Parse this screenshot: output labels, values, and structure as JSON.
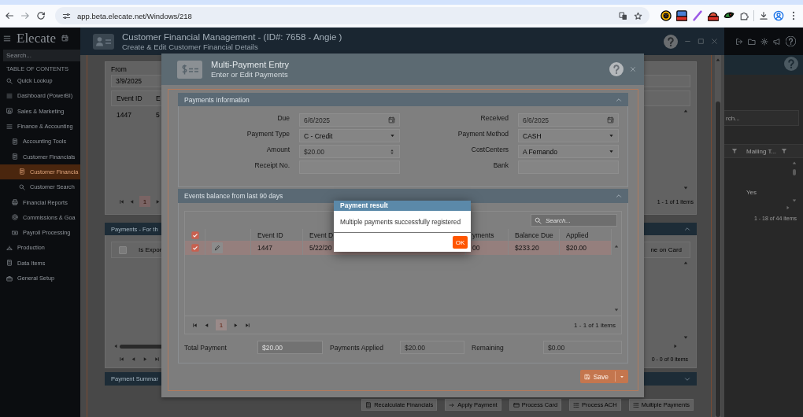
{
  "browser": {
    "url": "app.beta.elecate.net/Windows/218"
  },
  "sidebar": {
    "logo": "Elecate",
    "search": {
      "placeholder": "Search..."
    },
    "heading": "TABLE OF CONTENTS",
    "items": [
      {
        "label": "Quick Lookup",
        "selected": false
      },
      {
        "label": "Dashboard (PowerBI)",
        "selected": false
      },
      {
        "label": "Sales & Marketing",
        "selected": false
      },
      {
        "label": "Finance & Accounting",
        "selected": false,
        "children": [
          {
            "label": "Accounting Tools",
            "selected": false
          },
          {
            "label": "Customer Financials",
            "selected": false,
            "children": [
              {
                "label": "Customer Financia",
                "selected": true
              },
              {
                "label": "Customer Search",
                "selected": false
              }
            ]
          },
          {
            "label": "Financial Reports",
            "selected": false
          },
          {
            "label": "Commissions & Goa",
            "selected": false
          },
          {
            "label": "Payroll Processing",
            "selected": false
          }
        ]
      },
      {
        "label": "Production",
        "selected": false
      },
      {
        "label": "Data Items",
        "selected": false
      },
      {
        "label": "General Setup",
        "selected": false
      }
    ]
  },
  "window": {
    "title": "Customer Financial Management - (ID#: 7658 - Angie )",
    "subtitle": "Create & Edit Customer Financial Details",
    "events_panel": {
      "from_label": "From",
      "from_value": "3/9/2025",
      "columns": [
        "Event ID",
        "E"
      ],
      "rows": [
        [
          "1447",
          "5"
        ]
      ],
      "pager": {
        "pages": [
          {
            "label": "1",
            "selected": true
          }
        ],
        "summary": "1 - 1 of 1 items"
      }
    },
    "payments_panel": {
      "title": "Payments - For th",
      "expanded": true,
      "select_all": {
        "checked": false
      },
      "columns": [
        "Is Expor",
        "ne on Card"
      ],
      "summary": "0 - 0 of 0 items"
    },
    "summary_panel": {
      "title": "Payment Summar",
      "expanded": false
    },
    "toolbar": [
      "Recalculate Financials",
      "Apply Payment",
      "Process Card",
      "Process ACH",
      "Multiple Payments"
    ]
  },
  "background_list": {
    "search": {
      "placeholder": "rch..."
    },
    "columns": [
      "Mailing T..."
    ],
    "cells": [
      "Yes"
    ],
    "summary": "1 - 18 of 44 items"
  },
  "modal": {
    "title": "Multi-Payment Entry",
    "subtitle": "Enter or Edit Payments",
    "payment_info": {
      "title": "Payments Information",
      "expanded": true,
      "fields": [
        {
          "label": "Due",
          "value": "6/6/2025",
          "kind": "date"
        },
        {
          "label": "Received",
          "value": "6/6/2025",
          "kind": "date"
        },
        {
          "label": "Payment Type",
          "value": "C - Credit",
          "kind": "select"
        },
        {
          "label": "Payment Method",
          "value": "CASH",
          "kind": "select"
        },
        {
          "label": "Amount",
          "value": "$20.00",
          "kind": "number"
        },
        {
          "label": "CostCenters",
          "value": "A Fernando",
          "kind": "select"
        },
        {
          "label": "Receipt No.",
          "kind": "text"
        },
        {
          "label": "Bank",
          "kind": "text"
        }
      ]
    },
    "events": {
      "title": "Events balance from last 90 days",
      "expanded": true,
      "search": {
        "placeholder": "Search..."
      },
      "select_all": {
        "checked": true
      },
      "columns": [
        "Event ID",
        "Event D",
        "yments",
        "Balance Due",
        "Applied"
      ],
      "rows": [
        {
          "selected": true,
          "checked": true,
          "cells": [
            "1447",
            "5/22/20",
            "00",
            "$233.20",
            "$20.00"
          ]
        }
      ],
      "pager": {
        "pages": [
          {
            "label": "1",
            "selected": true
          }
        ],
        "summary": "1 - 1 of 1 items"
      }
    },
    "totals": [
      {
        "label": "Total Payment",
        "value": "$20.00",
        "disabled": true
      },
      {
        "label": "Payments Applied",
        "value": "$20.00",
        "disabled": false
      },
      {
        "label": "Remaining",
        "value": "$0.00",
        "disabled": false
      }
    ],
    "save_button": "Save"
  },
  "dialog": {
    "title": "Payment result",
    "message": "Multiple payments successfully registered",
    "button": "OK"
  }
}
